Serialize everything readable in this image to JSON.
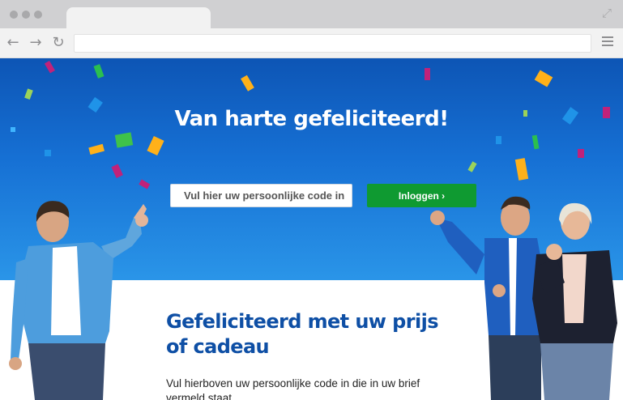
{
  "browser": {
    "address_value": ""
  },
  "hero": {
    "title": "Van harte gefeliciteerd!",
    "code_placeholder": "Vul hier uw persoonlijke code in",
    "login_label": "Inloggen ›"
  },
  "content": {
    "title": "Gefeliciteerd met uw prijs of cadeau",
    "text": "Vul hierboven uw persoonlijke code in die in uw brief vermeld staat"
  },
  "colors": {
    "hero_blue": "#1670d4",
    "title_blue": "#0e4fa5",
    "button_green": "#0f9a31"
  }
}
